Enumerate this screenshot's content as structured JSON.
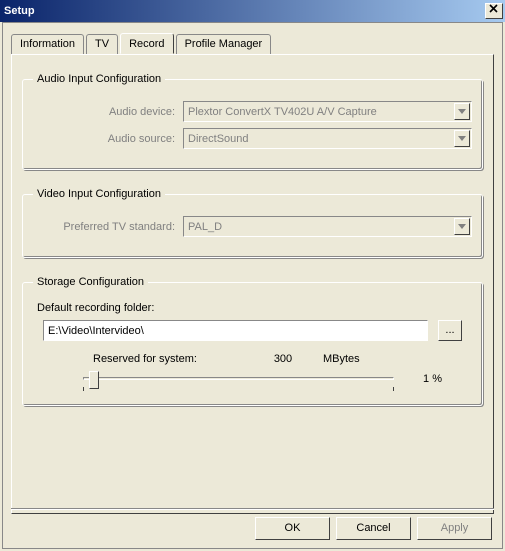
{
  "window": {
    "title": "Setup"
  },
  "tabs": [
    {
      "label": "Information"
    },
    {
      "label": "TV"
    },
    {
      "label": "Record"
    },
    {
      "label": "Profile Manager"
    }
  ],
  "groups": {
    "audio": {
      "legend": "Audio Input Configuration",
      "device_label": "Audio device:",
      "device_value": "Plextor ConvertX TV402U A/V Capture",
      "source_label": "Audio source:",
      "source_value": "DirectSound"
    },
    "video": {
      "legend": "Video Input Configuration",
      "std_label": "Preferred TV standard:",
      "std_value": "PAL_D"
    },
    "storage": {
      "legend": "Storage Configuration",
      "folder_label": "Default recording folder:",
      "folder_value": "E:\\Video\\Intervideo\\",
      "browse_label": "...",
      "reserved_label": "Reserved for system:",
      "reserved_value": "300",
      "reserved_unit": "MBytes",
      "slider_percent": "1 %",
      "slider_pos_pct": 2
    }
  },
  "buttons": {
    "ok": "OK",
    "cancel": "Cancel",
    "apply": "Apply"
  }
}
